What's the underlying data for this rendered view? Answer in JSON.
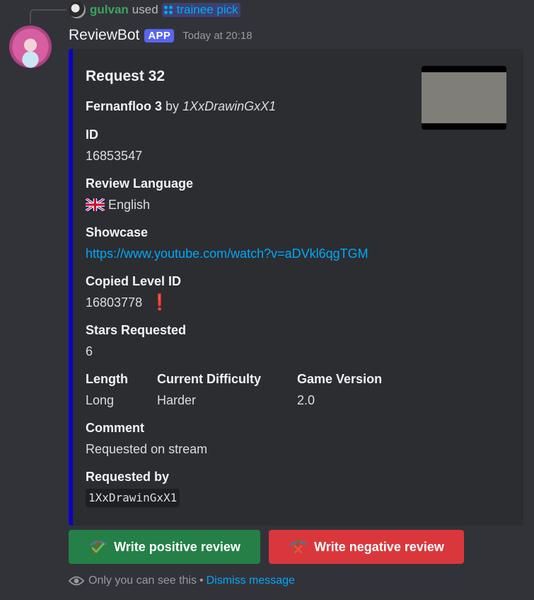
{
  "reply": {
    "user": "gulvan",
    "verb": "used",
    "command": "trainee pick",
    "user_color": "#3ba55c",
    "command_color": "#00a8fc"
  },
  "header": {
    "bot_name": "ReviewBot",
    "badge": "APP",
    "timestamp": "Today at 20:18"
  },
  "embed": {
    "accent_color": "#0d00c3",
    "title": "Request 32",
    "level_name": "Fernanfloo 3",
    "by_word": "by",
    "creator": "1XxDrawinGxX1",
    "fields": {
      "id": {
        "name": "ID",
        "value": "16853547"
      },
      "review_language": {
        "name": "Review Language",
        "value": "English",
        "flag_icon": "uk-flag-icon"
      },
      "showcase": {
        "name": "Showcase",
        "value": "https://www.youtube.com/watch?v=aDVkl6qgTGM"
      },
      "copied_level_id": {
        "name": "Copied Level ID",
        "value": "16803778",
        "badge": "❗"
      },
      "stars_requested": {
        "name": "Stars Requested",
        "value": "6"
      },
      "length": {
        "name": "Length",
        "value": "Long"
      },
      "current_difficulty": {
        "name": "Current Difficulty",
        "value": "Harder"
      },
      "game_version": {
        "name": "Game Version",
        "value": "2.0"
      },
      "comment": {
        "name": "Comment",
        "value": "Requested on stream"
      },
      "requested_by": {
        "name": "Requested by",
        "value": "1XxDrawinGxX1"
      }
    }
  },
  "buttons": {
    "positive": {
      "label": "Write positive review",
      "icon": "pickaxe-check-icon",
      "color": "#248046"
    },
    "negative": {
      "label": "Write negative review",
      "icon": "pickaxe-cross-icon",
      "color": "#da373c"
    }
  },
  "ephemeral": {
    "text": "Only you can see this",
    "separator": "•",
    "dismiss": "Dismiss message"
  }
}
